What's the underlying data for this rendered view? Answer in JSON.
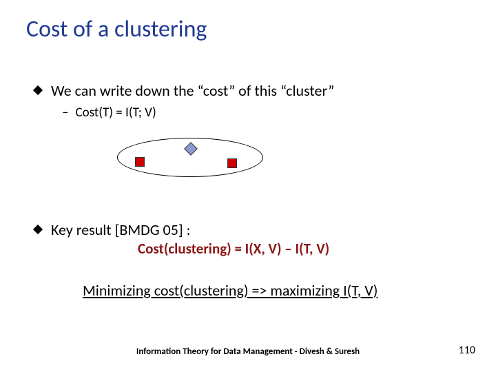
{
  "title": "Cost of a clustering",
  "bullet1": "We can write down the “cost” of this “cluster”",
  "sub1": "Cost(T) = I(T; V)",
  "bullet2": "Key result [BMDG 05] :",
  "formula": "Cost(clustering) = I(X, V) – I(T, V)",
  "minimizing": "Minimizing cost(clustering) => maximizing I(T, V)",
  "footer": "Information Theory for Data Management - Divesh & Suresh",
  "pagenum": "110"
}
